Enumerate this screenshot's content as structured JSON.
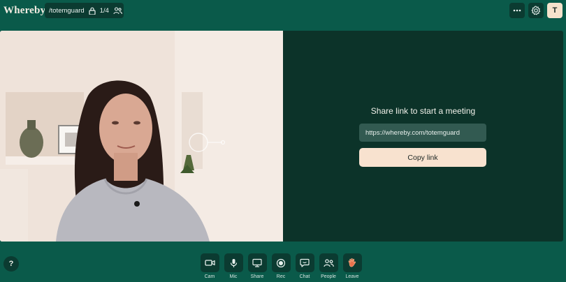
{
  "app": {
    "logo": "Whereby"
  },
  "room": {
    "name": "/totemguard",
    "participants": "1/4"
  },
  "header": {
    "more_icon": "more-icon",
    "settings_icon": "gear-icon",
    "avatar_initial": "T"
  },
  "share": {
    "title": "Share link to start a meeting",
    "link": "https://whereby.com/totemguard",
    "copy_label": "Copy link"
  },
  "toolbar": {
    "help_label": "?",
    "items": [
      {
        "label": "Cam",
        "icon": "camera-icon"
      },
      {
        "label": "Mic",
        "icon": "microphone-icon"
      },
      {
        "label": "Share",
        "icon": "screen-share-icon"
      },
      {
        "label": "Rec",
        "icon": "record-icon"
      },
      {
        "label": "Chat",
        "icon": "chat-icon"
      },
      {
        "label": "People",
        "icon": "people-icon"
      },
      {
        "label": "Leave",
        "icon": "wave-hand-icon"
      }
    ]
  },
  "colors": {
    "background": "#0a5a4a",
    "panel": "#0c3329",
    "button": "#0b3b31",
    "accent": "#f8e2cf"
  }
}
